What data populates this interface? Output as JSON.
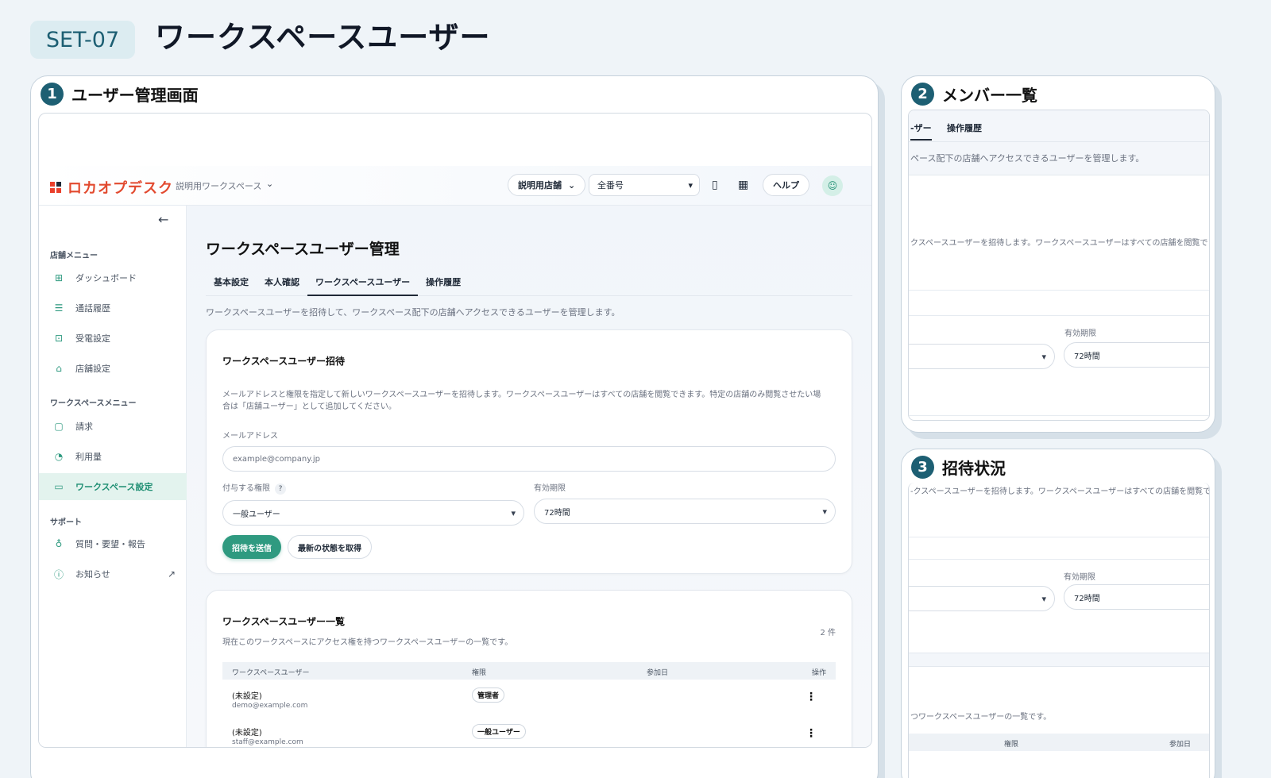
{
  "header": {
    "set_id": "SET-07",
    "title": "ワークスペースユーザー"
  },
  "panels": [
    {
      "num": "1",
      "label": "ユーザー管理画面"
    },
    {
      "num": "2",
      "label": "メンバー一覧"
    },
    {
      "num": "3",
      "label": "招待状況"
    }
  ],
  "app": {
    "logo": "ロカオプデスク",
    "workspace": "説明用ワークスペース",
    "store_select": "説明用店舗",
    "number_select": "全番号",
    "help": "ヘルプ",
    "sidebar": {
      "section_store": "店舗メニュー",
      "section_workspace": "ワークスペースメニュー",
      "section_support": "サポート",
      "items": {
        "dashboard": "ダッシュボード",
        "call_history": "通話履歴",
        "receive": "受電設定",
        "store": "店舗設定",
        "billing": "請求",
        "usage": "利用量",
        "ws_settings": "ワークスペース設定",
        "feedback": "質問・要望・報告",
        "news": "お知らせ"
      }
    },
    "content": {
      "title": "ワークスペースユーザー管理",
      "tabs": [
        "基本設定",
        "本人確認",
        "ワークスペースユーザー",
        "操作履歴"
      ],
      "description": "ワークスペースユーザーを招待して、ワークスペース配下の店舗へアクセスできるユーザーを管理します。",
      "invite": {
        "title": "ワークスペースユーザー招待",
        "text_line1": "メールアドレスと権限を指定して新しいワークスペースユーザーを招待します。ワークスペースユーザーはすべての店舗を閲覧できます。特定の店舗のみ閲覧させたい場",
        "text_line2": "合は「店舗ユーザー」として追加してください。",
        "email_label": "メールアドレス",
        "email_placeholder": "example@company.jp",
        "role_label": "付与する権限",
        "role_help": "?",
        "role_value": "一般ユーザー",
        "expiry_label": "有効期限",
        "expiry_value": "72時間",
        "send_button": "招待を送信",
        "refresh_button": "最新の状態を取得"
      },
      "list": {
        "title": "ワークスペースユーザー一覧",
        "count": "2 件",
        "description": "現在このワークスペースにアクセス権を持つワークスペースユーザーの一覧です。",
        "columns": [
          "ワークスペースユーザー",
          "権限",
          "参加日",
          "操作"
        ],
        "rows": [
          {
            "name": "(未設定)",
            "email": "demo@example.com",
            "role": "管理者"
          },
          {
            "name": "(未設定)",
            "email": "staff@example.com",
            "role": "一般ユーザー"
          }
        ]
      }
    }
  },
  "crop2": {
    "tab_partial": "-ザー",
    "tab_history": "操作履歴",
    "desc_partial": "ペース配下の店舗へアクセスできるユーザーを管理します。",
    "invite_partial": "クスペースユーザーを招待します。ワークスペースユーザーはすべての店舗を閲覧でき",
    "expiry_label": "有効期限",
    "expiry_value": "72時間"
  },
  "crop3": {
    "invite_partial": "-クスペースユーザーを招待します。ワークスペースユーザーはすべての店舗を閲覧できま",
    "expiry_label": "有効期限",
    "expiry_value": "72時間",
    "list_partial": "つワークスペースユーザーの一覧です。",
    "col_role": "権限",
    "col_date": "参加日"
  }
}
